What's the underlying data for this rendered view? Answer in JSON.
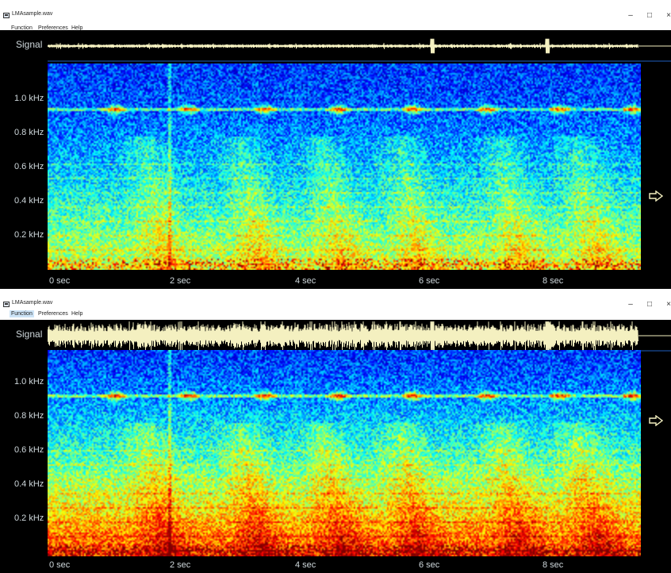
{
  "windows": [
    {
      "title": "LMAsample.wav",
      "menu": [
        "Function",
        "Preferences",
        "Help"
      ],
      "menu_highlight": -1,
      "controls": {
        "minimize": "–",
        "maximize": "□",
        "close": "×"
      },
      "signal_label": "Signal",
      "y_axis_labels": [
        "1.0 kHz",
        "0.8 kHz",
        "0.6 kHz",
        "0.4 kHz",
        "0.2 kHz"
      ],
      "x_axis_labels": [
        "0 sec",
        "2 sec",
        "4 sec",
        "6 sec",
        "8 sec"
      ],
      "signal_amplitude": 0.12,
      "spectrogram_gain": 0.0
    },
    {
      "title": "LMAsample.wav",
      "menu": [
        "Function",
        "Preferences",
        "Help"
      ],
      "menu_highlight": 0,
      "controls": {
        "minimize": "–",
        "maximize": "□",
        "close": "×"
      },
      "signal_label": "Signal",
      "y_axis_labels": [
        "1.0 kHz",
        "0.8 kHz",
        "0.6 kHz",
        "0.4 kHz",
        "0.2 kHz"
      ],
      "x_axis_labels": [
        "0 sec",
        "2 sec",
        "4 sec",
        "6 sec",
        "8 sec"
      ],
      "signal_amplitude": 0.85,
      "spectrogram_gain": 0.22
    }
  ],
  "colors": {
    "signal": "#f4f0c0",
    "background": "#000000",
    "label": "#cfd8dc",
    "menu_highlight": "#cde4f7"
  },
  "icons": {
    "next": "right-arrow-outline-icon",
    "app": "window-app-icon"
  }
}
